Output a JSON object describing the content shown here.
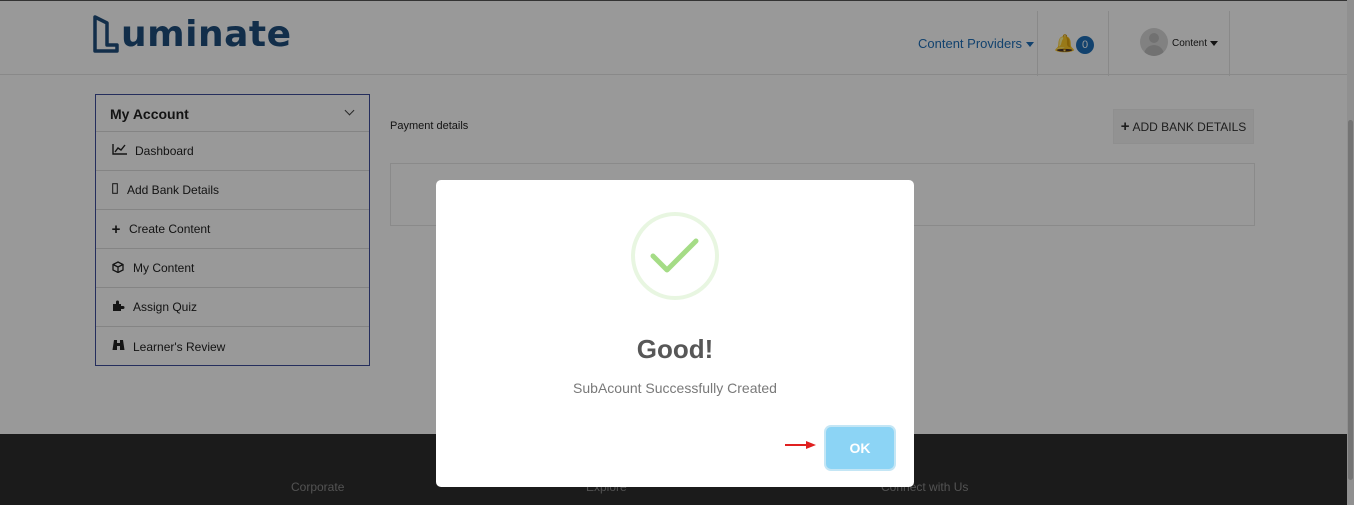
{
  "header": {
    "brand": "uminate",
    "nav_providers": "Content Providers",
    "notification_count": "0",
    "user_label": "Content"
  },
  "sidebar": {
    "title": "My Account",
    "items": [
      {
        "label": "Dashboard",
        "icon": "chart-line-icon",
        "glyph": "📈"
      },
      {
        "label": "Add Bank Details",
        "icon": "bank-card-icon",
        "glyph": "▯"
      },
      {
        "label": "Create Content",
        "icon": "plus-icon",
        "glyph": "✚"
      },
      {
        "label": "My Content",
        "icon": "cube-icon",
        "glyph": "⬢"
      },
      {
        "label": "Assign Quiz",
        "icon": "puzzle-icon",
        "glyph": "♞"
      },
      {
        "label": "Learner's Review",
        "icon": "binoculars-icon",
        "glyph": "⛬"
      }
    ]
  },
  "main": {
    "payment_title": "Payment details",
    "add_bank_label": "ADD BANK DETAILS"
  },
  "footer": {
    "columns": [
      "Corporate",
      "Explore",
      "Connect with Us"
    ]
  },
  "modal": {
    "title": "Good!",
    "message": "SubAcount Successfully Created",
    "ok_label": "OK"
  },
  "colors": {
    "brand": "#1e4e7c",
    "link": "#1e6fb8",
    "success": "#a5dc86",
    "ok_button": "#8cd4f5",
    "footer_bg": "#2e2e2e"
  }
}
